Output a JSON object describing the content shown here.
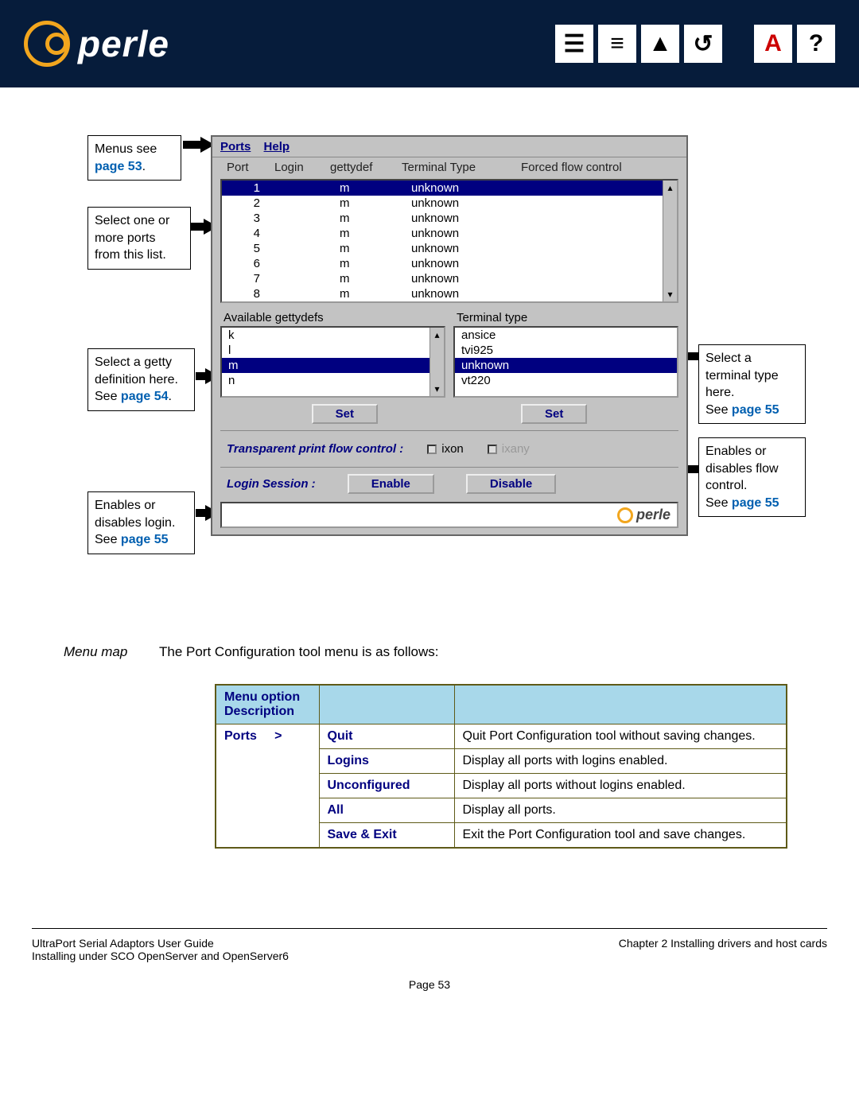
{
  "header": {
    "brand": "perle"
  },
  "callouts": {
    "menus": {
      "text": "Menus see",
      "link": "page 53"
    },
    "select_ports": "Select one or more ports from this list.",
    "select_getty": {
      "text": "Select a getty definition here.",
      "see": "See ",
      "link": "page 54"
    },
    "login": {
      "text": "Enables or disables login.",
      "see": "See ",
      "link": "page 55"
    },
    "term_type": {
      "text": "Select a terminal type here.",
      "see": "See ",
      "link": "page 55"
    },
    "flow": {
      "text": "Enables or disables flow control.",
      "see": "See ",
      "link": "page 55"
    }
  },
  "app": {
    "menu1": "Ports",
    "menu2": "Help",
    "cols": {
      "c1": "Port",
      "c2": "Login",
      "c3": "gettydef",
      "c4": "Terminal Type",
      "c5": "Forced flow control"
    },
    "rows": [
      {
        "p": "1",
        "l": "m",
        "t": "unknown",
        "sel": true
      },
      {
        "p": "2",
        "l": "m",
        "t": "unknown"
      },
      {
        "p": "3",
        "l": "m",
        "t": "unknown"
      },
      {
        "p": "4",
        "l": "m",
        "t": "unknown"
      },
      {
        "p": "5",
        "l": "m",
        "t": "unknown"
      },
      {
        "p": "6",
        "l": "m",
        "t": "unknown"
      },
      {
        "p": "7",
        "l": "m",
        "t": "unknown"
      },
      {
        "p": "8",
        "l": "m",
        "t": "unknown"
      }
    ],
    "getty_label": "Available gettydefs",
    "getty_items": [
      {
        "v": "k"
      },
      {
        "v": "l"
      },
      {
        "v": "m",
        "sel": true
      },
      {
        "v": "n"
      }
    ],
    "term_label": "Terminal type",
    "term_items": [
      {
        "v": "ansice"
      },
      {
        "v": "tvi925"
      },
      {
        "v": "unknown",
        "sel": true
      },
      {
        "v": "vt220"
      }
    ],
    "set_btn": "Set",
    "tpfc_label": "Transparent print flow control :",
    "tpfc_opt1": "ixon",
    "tpfc_opt2": "ixany",
    "login_label": "Login Session :",
    "enable_btn": "Enable",
    "disable_btn": "Disable",
    "footer_brand": "perle"
  },
  "menumap": {
    "label": "Menu map",
    "intro": "The Port Configuration tool menu is as follows:",
    "th": "Menu option Description",
    "ports": "Ports     >",
    "items": [
      {
        "o": "Quit",
        "d": "Quit Port Configuration tool without saving changes."
      },
      {
        "o": "Logins",
        "d": "Display all ports with logins enabled."
      },
      {
        "o": "Unconfigured",
        "d": "Display all ports without logins enabled."
      },
      {
        "o": "All",
        "d": "Display all ports."
      },
      {
        "o": "Save & Exit",
        "d": "Exit the Port Configuration tool and save changes."
      }
    ]
  },
  "footer": {
    "left1": "UltraPort Serial Adaptors User Guide",
    "left2": "Installing under SCO OpenServer and OpenServer6",
    "right": "Chapter 2 Installing drivers and host cards",
    "page": "Page 53"
  }
}
